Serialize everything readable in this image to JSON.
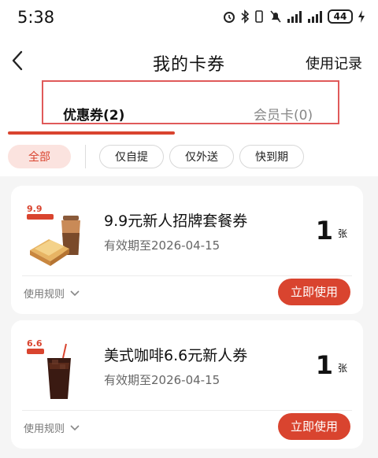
{
  "status_bar": {
    "time": "5:38",
    "battery": "44",
    "icons": [
      "alarm-icon",
      "bluetooth-icon",
      "vibrate-icon",
      "mute-icon",
      "signal-icon",
      "signal-icon",
      "battery-icon",
      "charging-icon"
    ]
  },
  "header": {
    "title": "我的卡券",
    "right_link": "使用记录",
    "back_icon": "chevron-left-icon"
  },
  "tabs": [
    {
      "label": "优惠券(2)",
      "active": true
    },
    {
      "label": "会员卡(0)",
      "active": false
    }
  ],
  "filters": [
    {
      "label": "全部",
      "active": true
    },
    {
      "label": "仅自提",
      "active": false
    },
    {
      "label": "仅外送",
      "active": false
    },
    {
      "label": "快到期",
      "active": false
    }
  ],
  "coupons": [
    {
      "title": "9.9元新人招牌套餐券",
      "expiry": "有效期至2026-04-15",
      "count": "1",
      "unit": "张",
      "rules_label": "使用规则",
      "use_label": "立即使用",
      "thumb_badge": "9.9"
    },
    {
      "title": "美式咖啡6.6元新人券",
      "expiry": "有效期至2026-04-15",
      "count": "1",
      "unit": "张",
      "rules_label": "使用规则",
      "use_label": "立即使用",
      "thumb_badge": "6.6"
    }
  ],
  "colors": {
    "accent": "#d9442f",
    "chip_active_bg": "#fbe3df",
    "highlight_box": "#e05a5a"
  }
}
